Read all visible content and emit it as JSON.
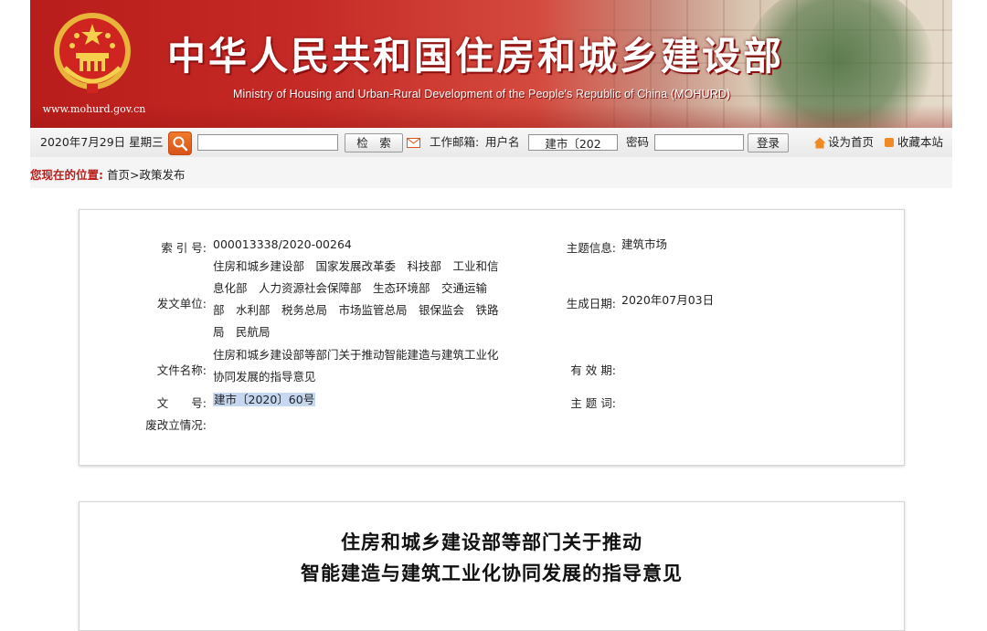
{
  "header": {
    "title_cn": "中华人民共和国住房和城乡建设部",
    "title_en": "Ministry of Housing and Urban-Rural Development of the People's Republic of China (MOHURD)",
    "site_url": "www.mohurd.gov.cn",
    "colors": {
      "banner_red": "#b81d1b",
      "title_text": "#ffffff"
    }
  },
  "toolbar": {
    "date": "2020年7月29日",
    "weekday": "星期三",
    "search_icon": "search-icon",
    "search_value": "",
    "search_button": "检　索",
    "mail_label": "工作邮箱:",
    "username_label": "用户名",
    "username_value": "建市〔202",
    "password_label": "密码",
    "password_value": "",
    "login_button": "登录",
    "set_home": "设为首页",
    "bookmark": "收藏本站"
  },
  "breadcrumb": {
    "label": "您现在的位置:",
    "path": "首页>政策发布"
  },
  "info": {
    "index_label": "索 引 号:",
    "index_value": "000013338/2020-00264",
    "topic_label": "主题信息:",
    "topic_value": "建筑市场",
    "issuer_label": "发文单位:",
    "issuer_lines": [
      "住房和城乡建设部　国家发展改革委　科技部　工业和信",
      "息化部　人力资源社会保障部　生态环境部　交通运输",
      "部　水利部　税务总局　市场监管总局　银保监会　铁路",
      "局　民航局"
    ],
    "date_label": "生成日期:",
    "date_value": "2020年07月03日",
    "filename_label": "文件名称:",
    "filename_lines": [
      "住房和城乡建设部等部门关于推动智能建造与建筑工业化",
      "协同发展的指导意见"
    ],
    "validity_label": "有 效 期:",
    "docno_label": "文　　号:",
    "docno_value": "建市〔2020〕60号",
    "keywords_label": "主 题 词:",
    "status_label": "废改立情况:"
  },
  "article": {
    "title_line1": "住房和城乡建设部等部门关于推动",
    "title_line2": "智能建造与建筑工业化协同发展的指导意见"
  }
}
